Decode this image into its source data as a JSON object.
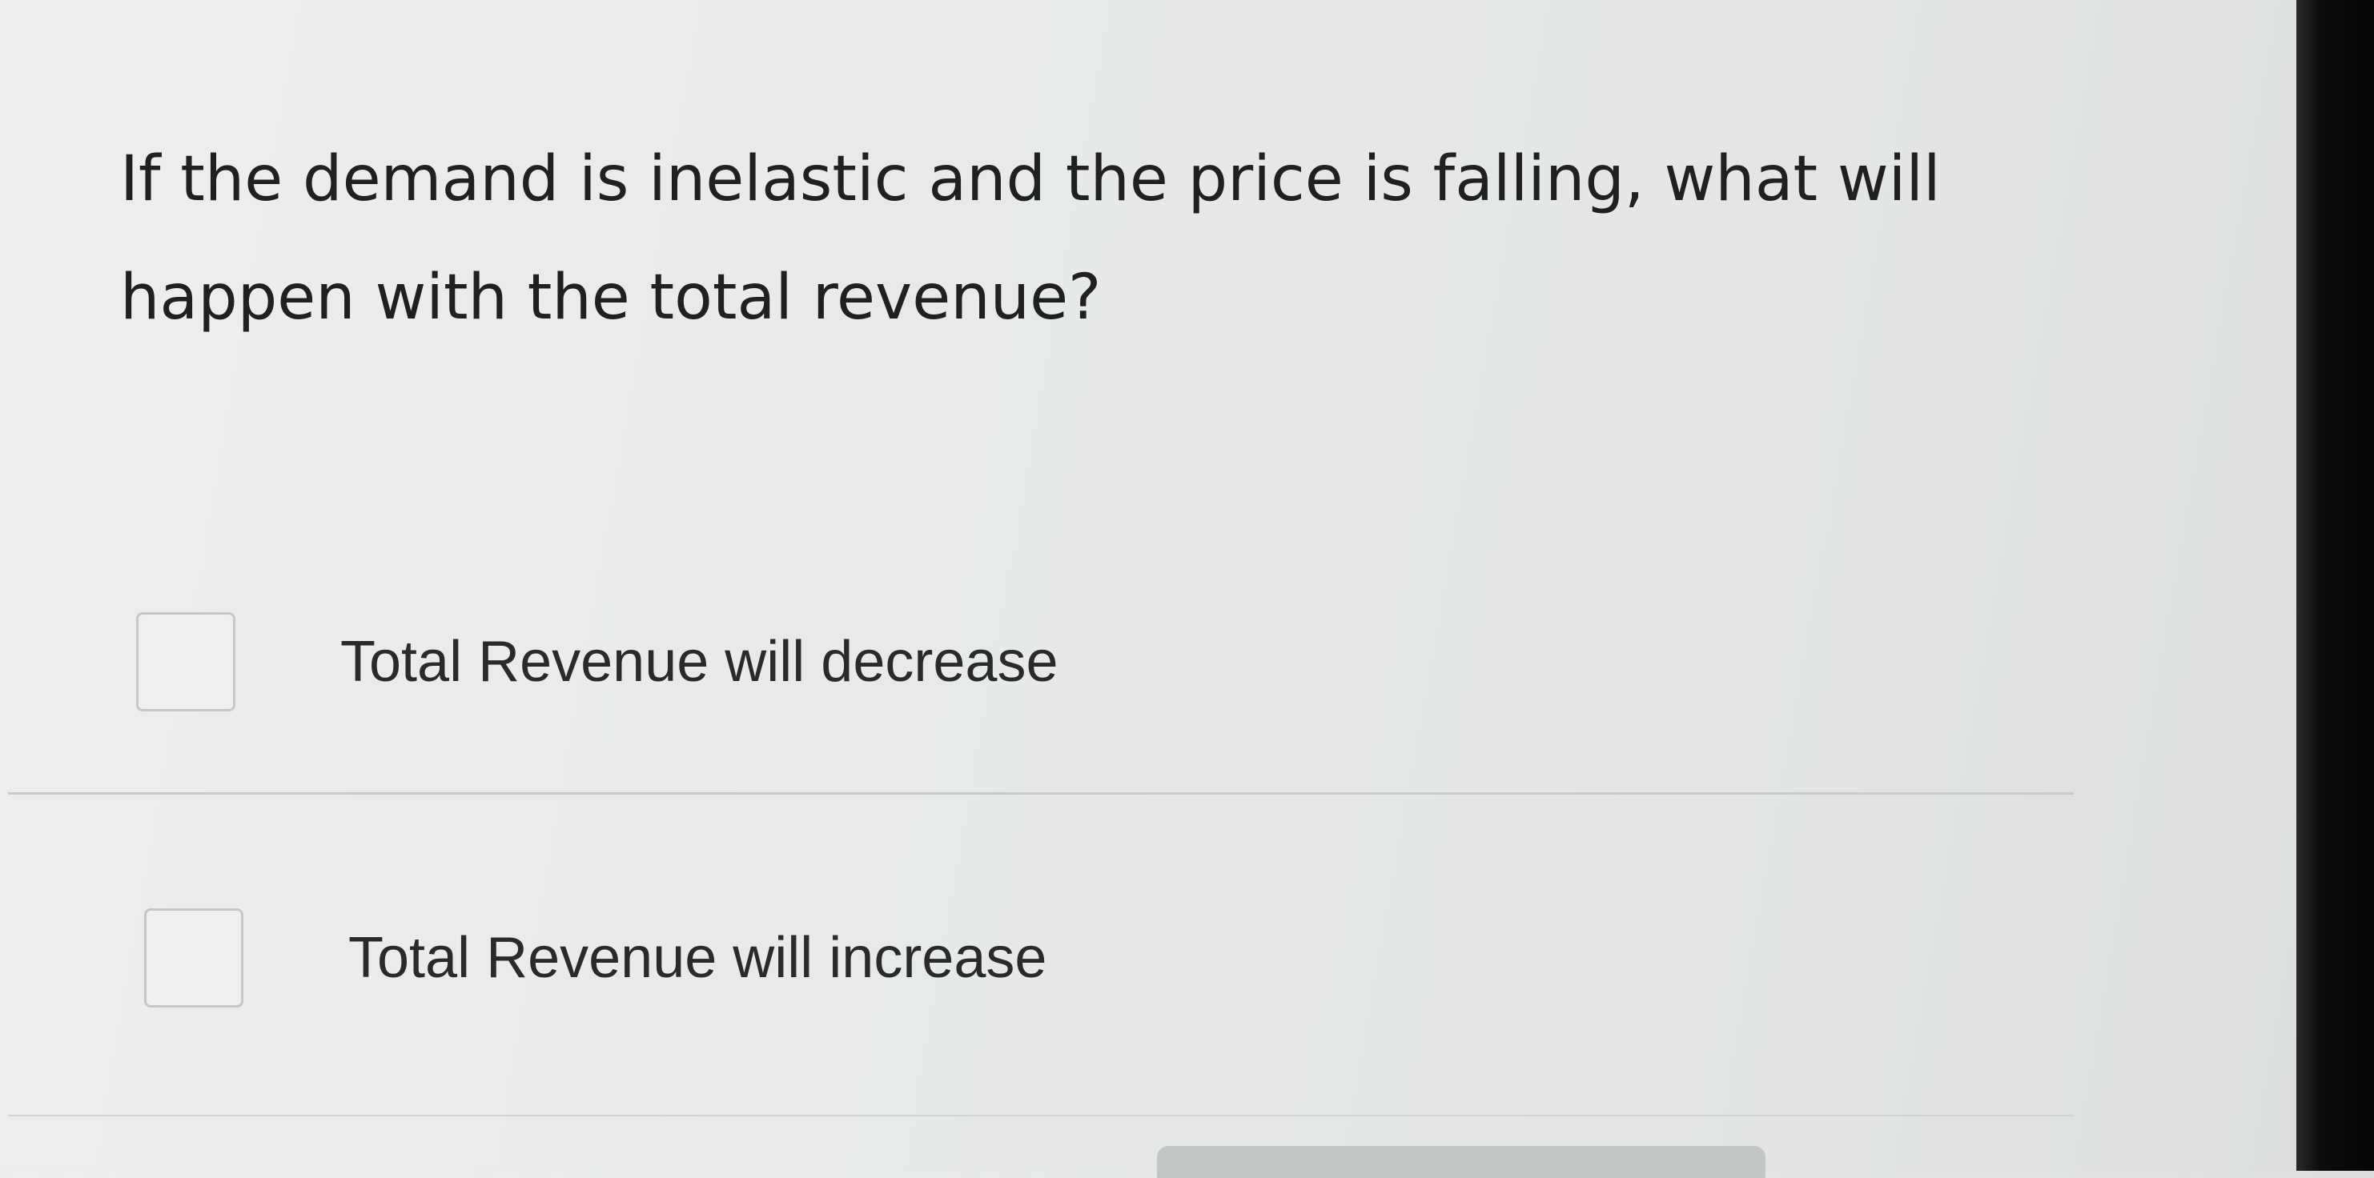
{
  "question": {
    "text": "If the demand is inelastic and the price is falling, what will happen with the total revenue?"
  },
  "options": [
    {
      "label": "Total Revenue will decrease",
      "checked": false
    },
    {
      "label": "Total Revenue will increase",
      "checked": false
    }
  ],
  "colors": {
    "text": "#202020",
    "checkbox_border": "#c6c8c7",
    "divider": "#c9cbca"
  }
}
